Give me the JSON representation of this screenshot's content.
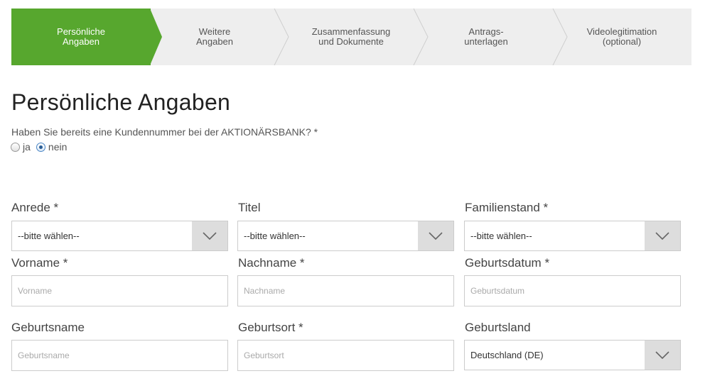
{
  "steps": [
    {
      "label": "Persönliche\nAngaben",
      "active": true
    },
    {
      "label": "Weitere\nAngaben",
      "active": false
    },
    {
      "label": "Zusammenfassung\nund Dokumente",
      "active": false
    },
    {
      "label": "Antrags-\nunterlagen",
      "active": false
    },
    {
      "label": "Videolegitimation\n(optional)",
      "active": false
    }
  ],
  "page_title": "Persönliche Angaben",
  "customer_question": "Haben Sie bereits eine Kundennummer bei der AKTIONÄRSBANK? *",
  "radio": {
    "yes": "ja",
    "no": "nein",
    "selected": "nein"
  },
  "form": {
    "anrede": {
      "label": "Anrede *",
      "value": "--bitte wählen--"
    },
    "titel": {
      "label": "Titel",
      "value": "--bitte wählen--"
    },
    "familienstand": {
      "label": "Familienstand *",
      "value": "--bitte wählen--"
    },
    "vorname": {
      "label": "Vorname *",
      "placeholder": "Vorname"
    },
    "nachname": {
      "label": "Nachname *",
      "placeholder": "Nachname"
    },
    "geburtsdatum": {
      "label": "Geburtsdatum *",
      "placeholder": "Geburtsdatum"
    },
    "geburtsname": {
      "label": "Geburtsname",
      "placeholder": "Geburtsname"
    },
    "geburtsort": {
      "label": "Geburtsort *",
      "placeholder": "Geburtsort"
    },
    "geburtsland": {
      "label": "Geburtsland",
      "value": "Deutschland (DE)"
    }
  },
  "colors": {
    "accent": "#57a72e",
    "step_bg": "#eeeeee",
    "select_button": "#dddddd"
  },
  "icons": {
    "select_arrow": "chevron-down-icon",
    "step_separator": "chevron-right-icon"
  }
}
